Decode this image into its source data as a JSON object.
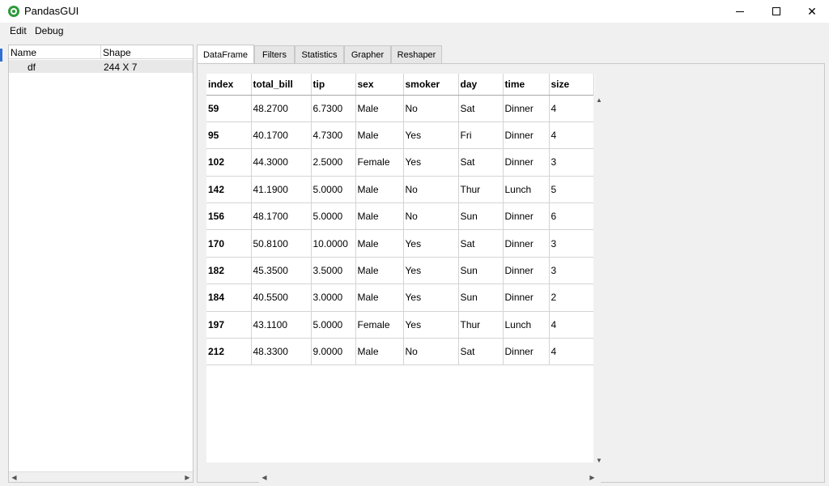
{
  "window": {
    "title": "PandasGUI"
  },
  "menubar": {
    "edit": "Edit",
    "debug": "Debug"
  },
  "left_panel": {
    "headers": {
      "name": "Name",
      "shape": "Shape"
    },
    "rows": [
      {
        "name": "df",
        "shape": "244 X 7"
      }
    ]
  },
  "tabs": [
    "DataFrame",
    "Filters",
    "Statistics",
    "Grapher",
    "Reshaper"
  ],
  "active_tab": "DataFrame",
  "table": {
    "columns": [
      "index",
      "total_bill",
      "tip",
      "sex",
      "smoker",
      "day",
      "time",
      "size"
    ],
    "rows": [
      [
        "59",
        "48.2700",
        "6.7300",
        "Male",
        "No",
        "Sat",
        "Dinner",
        "4"
      ],
      [
        "95",
        "40.1700",
        "4.7300",
        "Male",
        "Yes",
        "Fri",
        "Dinner",
        "4"
      ],
      [
        "102",
        "44.3000",
        "2.5000",
        "Female",
        "Yes",
        "Sat",
        "Dinner",
        "3"
      ],
      [
        "142",
        "41.1900",
        "5.0000",
        "Male",
        "No",
        "Thur",
        "Lunch",
        "5"
      ],
      [
        "156",
        "48.1700",
        "5.0000",
        "Male",
        "No",
        "Sun",
        "Dinner",
        "6"
      ],
      [
        "170",
        "50.8100",
        "10.0000",
        "Male",
        "Yes",
        "Sat",
        "Dinner",
        "3"
      ],
      [
        "182",
        "45.3500",
        "3.5000",
        "Male",
        "Yes",
        "Sun",
        "Dinner",
        "3"
      ],
      [
        "184",
        "40.5500",
        "3.0000",
        "Male",
        "Yes",
        "Sun",
        "Dinner",
        "2"
      ],
      [
        "197",
        "43.1100",
        "5.0000",
        "Female",
        "Yes",
        "Thur",
        "Lunch",
        "4"
      ],
      [
        "212",
        "48.3300",
        "9.0000",
        "Male",
        "No",
        "Sat",
        "Dinner",
        "4"
      ]
    ]
  },
  "icons": {
    "app": "pandasgui-icon",
    "minimize": "minimize-icon",
    "maximize": "maximize-icon",
    "close": "close-icon"
  },
  "colors": {
    "accent": "#2f6fd6",
    "app_icon": "#2e9b3a"
  }
}
